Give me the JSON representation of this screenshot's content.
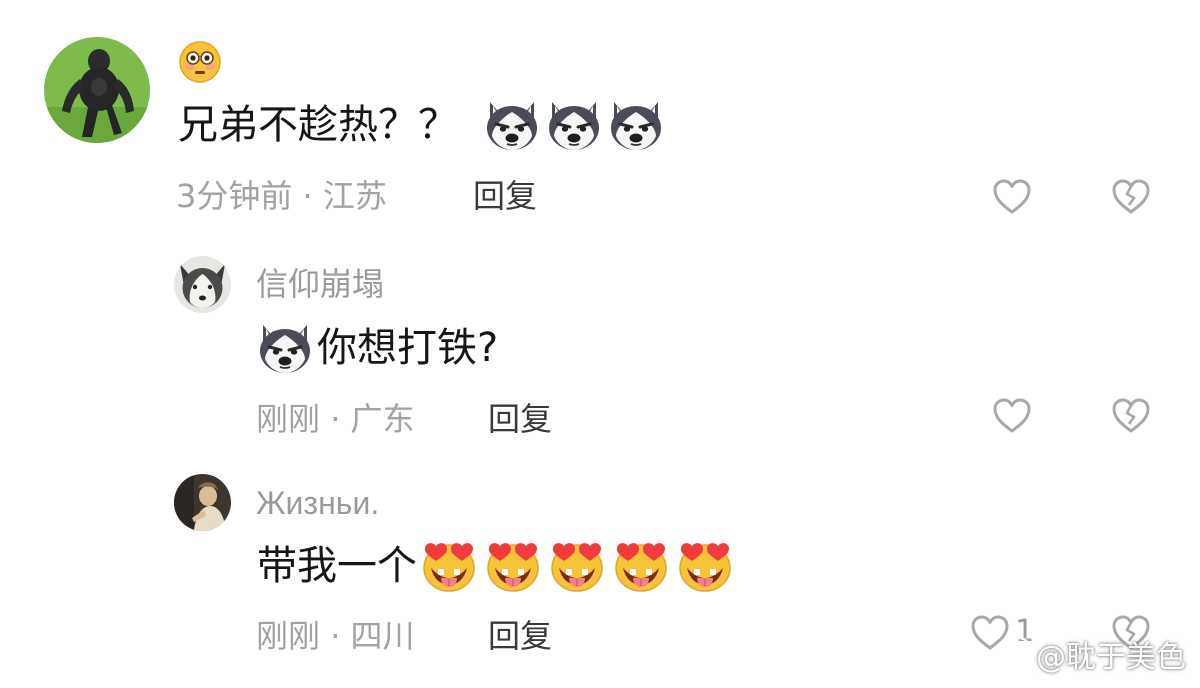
{
  "comments": [
    {
      "id": "main",
      "title_emoji": "😳",
      "text": "兄弟不趁热？？",
      "emotes": [
        "husky",
        "husky",
        "husky"
      ],
      "time": "3分钟前",
      "separator": "·",
      "location": "江苏",
      "reply_label": "回复"
    },
    {
      "id": "reply1",
      "username": "信仰崩塌",
      "pre_emotes": [
        "husky"
      ],
      "text": "你想打铁?",
      "time": "刚刚",
      "separator": "·",
      "location": "广东",
      "reply_label": "回复"
    },
    {
      "id": "reply2",
      "username": "Жизньи.",
      "text": "带我一个",
      "emotes": [
        "heart-eyes",
        "heart-eyes",
        "heart-eyes",
        "heart-eyes",
        "heart-eyes"
      ],
      "time": "刚刚",
      "separator": "·",
      "location": "四川",
      "reply_label": "回复",
      "like_count": "1"
    }
  ],
  "watermark": {
    "text": "@耽于美色"
  },
  "colors": {
    "muted": "#a2a2a2",
    "reply": "#3a3a3a",
    "icon": "#a8a8a8"
  }
}
